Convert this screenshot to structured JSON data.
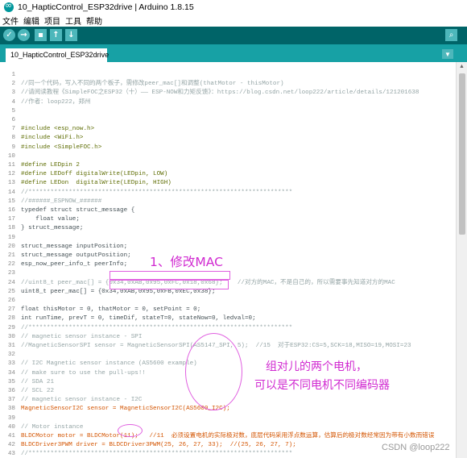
{
  "window": {
    "title": "10_HapticControl_ESP32drive | Arduino 1.8.15"
  },
  "menu": [
    "文件",
    "编辑",
    "项目",
    "工具",
    "帮助"
  ],
  "toolbar": {
    "verify": "✓",
    "upload": "→",
    "new": "▪",
    "open": "↑",
    "save": "↓",
    "serial_monitor": "⌕"
  },
  "tab": {
    "label": "10_HapticControl_ESP32drive",
    "menu_icon": "▼"
  },
  "code_lines": [
    {
      "n": "1",
      "t": ""
    },
    {
      "n": "2",
      "t": "//同一个代码，写入不同的两个板子，需修改peer_mac[]和调整(thatMotor - thisMotor)"
    },
    {
      "n": "3",
      "t": "//请阅读教程《SimpleFOC之ESP32（十）—— ESP-NOW和力矩反馈》：https://blog.csdn.net/loop222/article/details/121201638"
    },
    {
      "n": "4",
      "t": "//作者：loop222，郑州"
    },
    {
      "n": "5",
      "t": ""
    },
    {
      "n": "6",
      "t": ""
    },
    {
      "n": "7",
      "t": "#include <esp_now.h>"
    },
    {
      "n": "8",
      "t": "#include <WiFi.h>"
    },
    {
      "n": "9",
      "t": "#include <SimpleFOC.h>"
    },
    {
      "n": "10",
      "t": ""
    },
    {
      "n": "11",
      "t": "#define LEDpin 2"
    },
    {
      "n": "12",
      "t": "#define LEDoff digitalWrite(LEDpin, LOW)"
    },
    {
      "n": "13",
      "t": "#define LEDon  digitalWrite(LEDpin, HIGH)"
    },
    {
      "n": "14",
      "t": "//************************************************************************"
    },
    {
      "n": "15",
      "t": "//######_ESPNOW_######"
    },
    {
      "n": "16",
      "t": "typedef struct struct_message {"
    },
    {
      "n": "17",
      "t": "    float value;"
    },
    {
      "n": "18",
      "t": "} struct_message;"
    },
    {
      "n": "19",
      "t": ""
    },
    {
      "n": "20",
      "t": "struct_message inputPosition;"
    },
    {
      "n": "21",
      "t": "struct_message outputPosition;"
    },
    {
      "n": "22",
      "t": "esp_now_peer_info_t peerInfo;"
    },
    {
      "n": "23",
      "t": ""
    },
    {
      "n": "24",
      "t": "//uint8_t peer_mac[] = {0x34,0xAB,0x95,0xFC,0x18,0x68};    //对方的MAC，不是自己的，所以需要事先知道对方的MAC"
    },
    {
      "n": "25",
      "t": "uint8_t peer_mac[] = {0x34,0xAB,0x95,0xFB,0xEC,0x38};"
    },
    {
      "n": "26",
      "t": ""
    },
    {
      "n": "27",
      "t": "float thisMotor = 0, thatMotor = 0, setPoint = 0;"
    },
    {
      "n": "28",
      "t": "int runTime, prevT = 0, timeDif, stateT=0, stateNow=0, ledval=0;"
    },
    {
      "n": "29",
      "t": "//************************************************************************"
    },
    {
      "n": "30",
      "t": "// magnetic sensor instance - SPI"
    },
    {
      "n": "31",
      "t": "//MagneticSensorSPI sensor = MagneticSensorSPI(AS5147_SPI, 5);  //15  对于ESP32:CS=5,SCK=18,MISO=19,MOSI=23"
    },
    {
      "n": "32",
      "t": ""
    },
    {
      "n": "33",
      "t": "// I2C Magnetic sensor instance (AS5600 example)"
    },
    {
      "n": "34",
      "t": "// make sure to use the pull-ups!!"
    },
    {
      "n": "35",
      "t": "// SDA 21"
    },
    {
      "n": "36",
      "t": "// SCL 22"
    },
    {
      "n": "37",
      "t": "// magnetic sensor instance - I2C"
    },
    {
      "n": "38",
      "t": "MagneticSensorI2C sensor = MagneticSensorI2C(AS5600_I2C);"
    },
    {
      "n": "39",
      "t": ""
    },
    {
      "n": "40",
      "t": "// Motor instance"
    },
    {
      "n": "41",
      "t": "BLDCMotor motor = BLDCMotor(11);   //11  必须设置电机的实际极对数，底层代码采用浮点数运算，估算后的极对数经常因为带有小数而错误"
    },
    {
      "n": "42",
      "t": "BLDCDriver3PWM driver = BLDCDriver3PWM(25, 26, 27, 33);  //(25, 26, 27, 7);"
    },
    {
      "n": "43",
      "t": "//************************************************************************"
    }
  ],
  "annotations": {
    "mac_note": "1、修改MAC",
    "motor_note_line1": "组对儿的两个电机，",
    "motor_note_line2": "可以是不同电机不同编码器"
  },
  "watermark": "CSDN @loop222",
  "colors": {
    "toolbar_bg": "#006468",
    "tab_bar_bg": "#17a1a5",
    "comment": "#95a5a6",
    "keyword": "#00979c",
    "type": "#d35400",
    "string": "#005c5f",
    "annotation": "#d12bd1"
  }
}
